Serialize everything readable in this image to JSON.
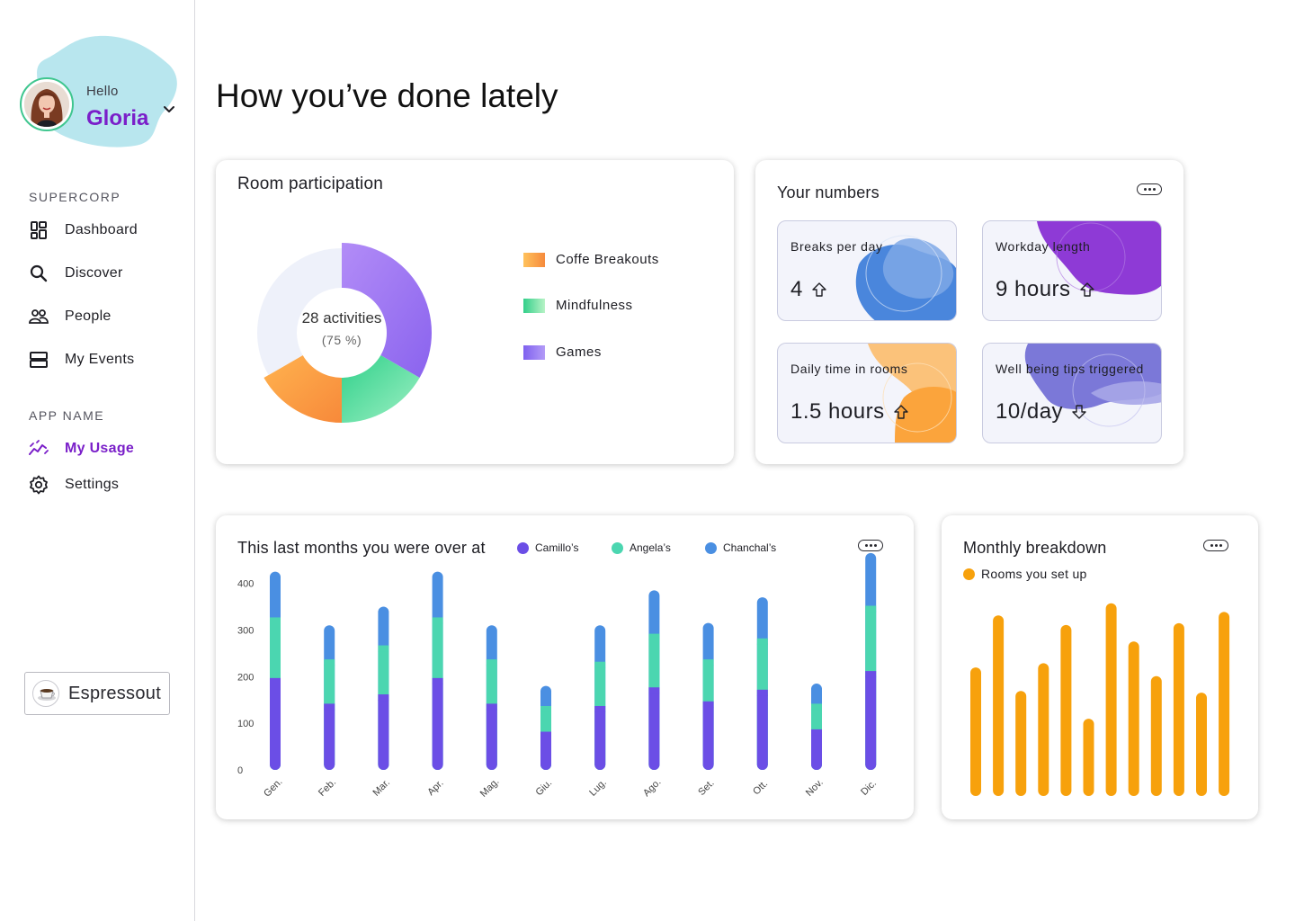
{
  "user": {
    "greeting": "Hello",
    "name": "Gloria"
  },
  "sidebar": {
    "sections": [
      {
        "label": "SUPERCORP",
        "items": [
          {
            "label": "Dashboard",
            "icon": "dashboard-icon"
          },
          {
            "label": "Discover",
            "icon": "search-icon"
          },
          {
            "label": "People",
            "icon": "people-icon"
          },
          {
            "label": "My Events",
            "icon": "events-icon"
          }
        ]
      },
      {
        "label": "APP NAME",
        "items": [
          {
            "label": "My Usage",
            "icon": "usage-trend-icon",
            "active": true
          },
          {
            "label": "Settings",
            "icon": "gear-icon"
          }
        ]
      }
    ],
    "app_switcher": {
      "label": "Espressout",
      "icon": "coffee-cup-icon"
    }
  },
  "page": {
    "title": "How you’ve done lately"
  },
  "room_participation": {
    "title": "Room participation",
    "center_value": "28 activities",
    "center_sub": "(75 %)",
    "legend": [
      {
        "label": "Coffe Breakouts",
        "color": "#f79a3c"
      },
      {
        "label": "Mindfulness",
        "color": "#36d18e"
      },
      {
        "label": "Games",
        "color": "#9b6cf2"
      }
    ],
    "chart_data": {
      "type": "pie",
      "categories": [
        "Games",
        "Mindfulness",
        "Coffe Breakouts",
        "Remaining"
      ],
      "values": [
        25,
        12.5,
        12.5,
        25
      ],
      "colors": [
        "#9b6cf2",
        "#36d18e",
        "#f79a3c",
        "#eef1fa"
      ],
      "style": "donut"
    }
  },
  "your_numbers": {
    "title": "Your numbers",
    "tiles": [
      {
        "label": "Breaks per day",
        "value": "4",
        "trend": "up",
        "accent": "#4a86dc"
      },
      {
        "label": "Workday length",
        "value": "9 hours",
        "trend": "up",
        "accent": "#8e3ad6"
      },
      {
        "label": "Daily time in rooms",
        "value": "1.5 hours",
        "trend": "up",
        "accent": "#fba43c"
      },
      {
        "label": "Well being tips triggered",
        "value": "10/day",
        "trend": "down",
        "accent": "#7b78d8"
      }
    ]
  },
  "monthly_rooms": {
    "title": "This last months you were over at",
    "colors": {
      "Camillo’s": "#6b4ee6",
      "Angela’s": "#4bd6b0",
      "Chanchal’s": "#4a8fe2"
    },
    "chart_data": {
      "type": "bar",
      "stacked": true,
      "categories": [
        "Gen.",
        "Feb.",
        "Mar.",
        "Apr.",
        "Mag.",
        "Giu.",
        "Lug.",
        "Ago.",
        "Set.",
        "Ott.",
        "Nov.",
        "Dic."
      ],
      "series": [
        {
          "name": "Camillo’s",
          "values": [
            195,
            140,
            160,
            195,
            140,
            80,
            135,
            175,
            145,
            170,
            85,
            210
          ]
        },
        {
          "name": "Angela’s",
          "values": [
            130,
            95,
            105,
            130,
            95,
            55,
            95,
            115,
            90,
            110,
            55,
            140
          ]
        },
        {
          "name": "Chanchal’s",
          "values": [
            100,
            75,
            85,
            100,
            75,
            45,
            80,
            95,
            80,
            90,
            45,
            115
          ]
        }
      ],
      "y_ticks": [
        0,
        100,
        200,
        300,
        400
      ],
      "ylim": [
        0,
        430
      ]
    }
  },
  "monthly_breakdown": {
    "title": "Monthly breakdown",
    "legend_label": "Rooms you set up",
    "color": "#f7a10c",
    "chart_data": {
      "type": "bar",
      "series": [
        {
          "name": "Rooms you set up",
          "values": [
            148,
            208,
            121,
            153,
            197,
            89,
            222,
            178,
            138,
            199,
            119,
            212
          ]
        }
      ],
      "ylim": [
        0,
        230
      ]
    }
  }
}
